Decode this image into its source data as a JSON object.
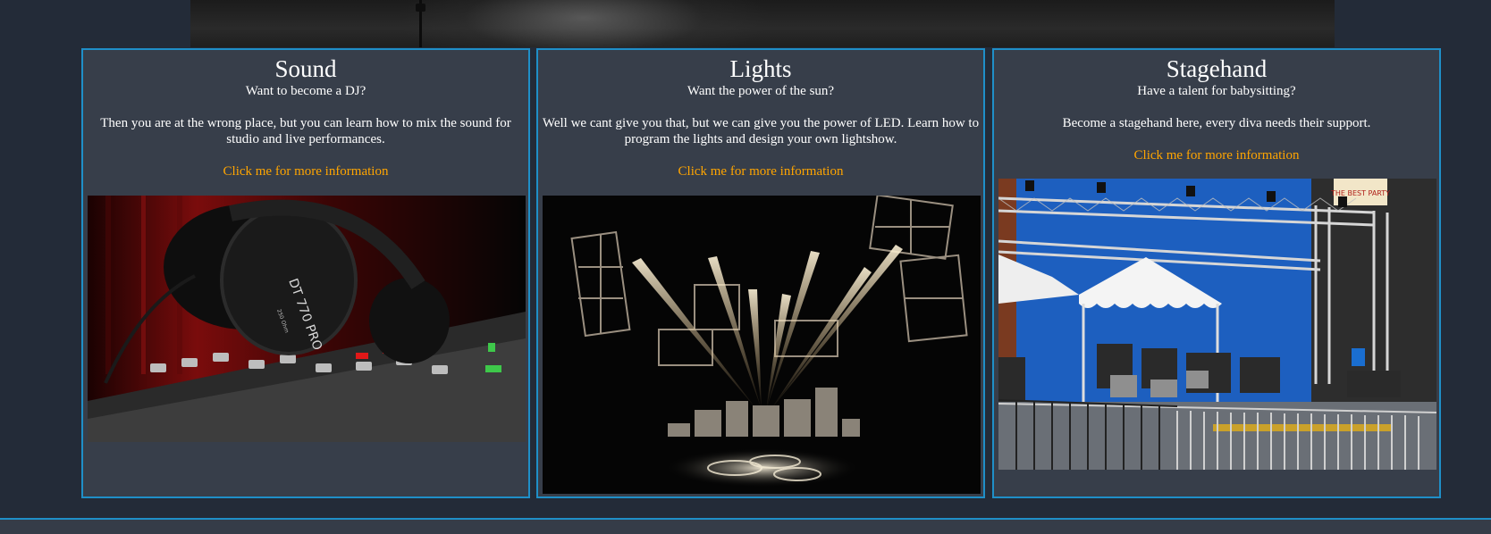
{
  "cards": [
    {
      "title": "Sound",
      "subtitle": "Want to become a DJ?",
      "description": "Then you are at the wrong place, but you can learn how to mix the sound for studio and live performances.",
      "link": "Click me for more information",
      "image_label": "DT 770 PRO",
      "image_sublabel": "250 Ohm"
    },
    {
      "title": "Lights",
      "subtitle": "Want the power of the sun?",
      "description": "Well we cant give you that, but we can give you the power of LED. Learn how to program the lights and design your own lightshow.",
      "link": "Click me for more information"
    },
    {
      "title": "Stagehand",
      "subtitle": "Have a talent for babysitting?",
      "description": "Become a stagehand here, every diva needs their support.",
      "link": "Click me for more information",
      "image_sign": "THE BEST PARTY"
    }
  ],
  "colors": {
    "page_background": "#232b38",
    "card_background": "#373e4a",
    "card_border": "#1f8fc8",
    "link": "#ffa500",
    "text": "#ffffff"
  }
}
